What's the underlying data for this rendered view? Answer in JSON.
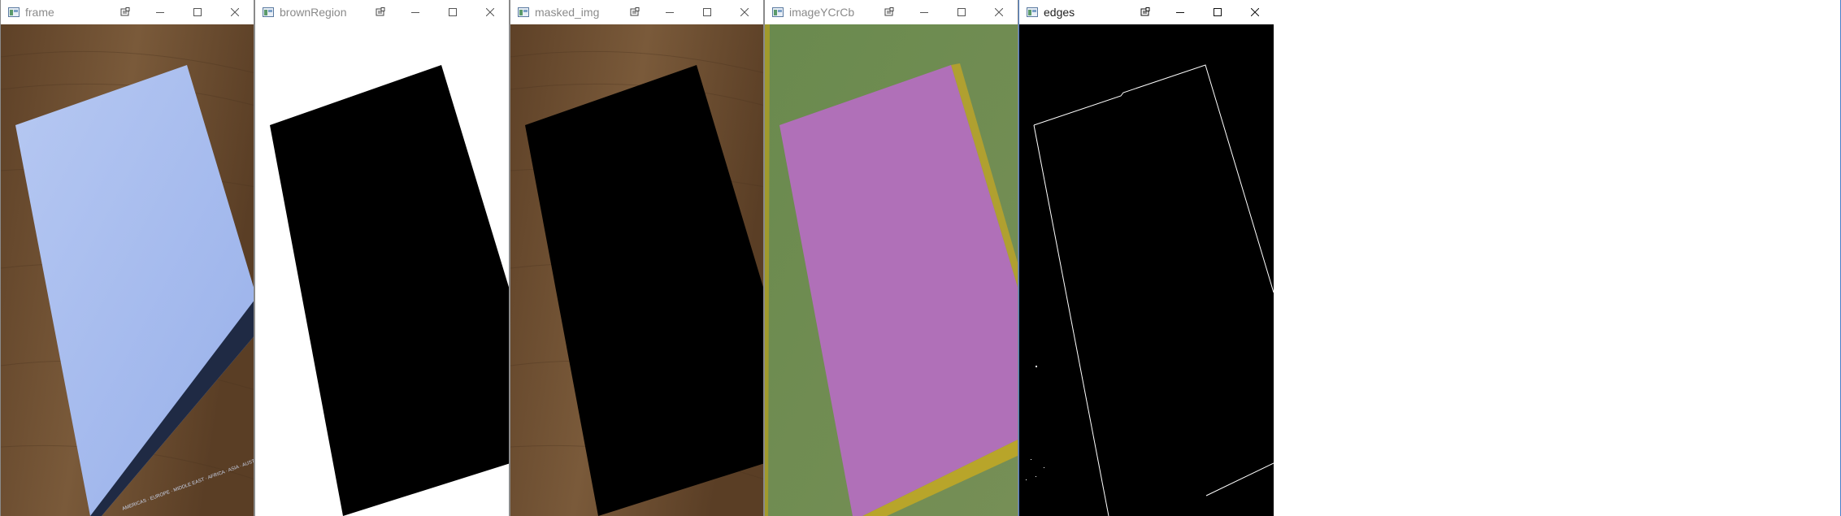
{
  "windows": [
    {
      "id": "frame",
      "title": "frame",
      "active": false
    },
    {
      "id": "brownRegion",
      "title": "brownRegion",
      "active": false
    },
    {
      "id": "masked_img",
      "title": "masked_img",
      "active": false
    },
    {
      "id": "imageYCrCb",
      "title": "imageYCrCb",
      "active": false
    },
    {
      "id": "edges",
      "title": "edges",
      "active": true
    }
  ],
  "frame_footer_text": "AMERICAS · EUROPE · MIDDLE EAST · AFRICA · ASIA · AUSTRALASIA",
  "colors": {
    "wood": "#6b4f33",
    "paper_blue": "#a9bff0",
    "ycrcb_green": "#6e8a52",
    "ycrcb_magenta": "#b06fb8",
    "ycrcb_yellow": "#b8a52a",
    "mask_black": "#000000",
    "mask_white": "#ffffff",
    "active_border": "#4a7fc8"
  },
  "icons": {
    "app": "opencv-window-icon",
    "properties": "properties-icon",
    "minimize": "minimize-icon",
    "maximize": "maximize-icon",
    "close": "close-icon"
  }
}
